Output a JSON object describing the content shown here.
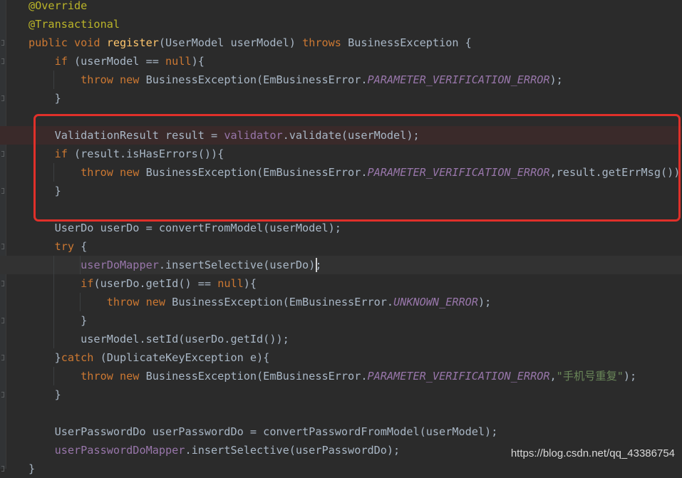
{
  "colors": {
    "background": "#2b2b2b",
    "keyword": "#cc7832",
    "annotation": "#bbb529",
    "method_declaration": "#ffc66d",
    "constant_italic": "#9876aa",
    "string": "#6a8759",
    "plain": "#a9b7c6",
    "highlight_box": "#e0302a"
  },
  "code_lines": [
    [
      {
        "t": "ann",
        "s": "@Override"
      }
    ],
    [
      {
        "t": "ann",
        "s": "@Transactional"
      }
    ],
    [
      {
        "t": "kw",
        "s": "public void "
      },
      {
        "t": "method",
        "s": "register"
      },
      {
        "t": "text",
        "s": "(UserModel userModel) "
      },
      {
        "t": "kw",
        "s": "throws "
      },
      {
        "t": "text",
        "s": "BusinessException {"
      }
    ],
    [
      {
        "t": "text",
        "s": "    "
      },
      {
        "t": "kw",
        "s": "if "
      },
      {
        "t": "text",
        "s": "(userModel == "
      },
      {
        "t": "kw",
        "s": "null"
      },
      {
        "t": "text",
        "s": "){"
      }
    ],
    [
      {
        "t": "text",
        "s": "        "
      },
      {
        "t": "kw",
        "s": "throw new "
      },
      {
        "t": "text",
        "s": "BusinessException(EmBusinessError."
      },
      {
        "t": "const",
        "s": "PARAMETER_VERIFICATION_ERROR"
      },
      {
        "t": "text",
        "s": ");"
      }
    ],
    [
      {
        "t": "text",
        "s": "    }"
      }
    ],
    [],
    [
      {
        "t": "text",
        "s": "    ValidationResult result = "
      },
      {
        "t": "field",
        "s": "validator"
      },
      {
        "t": "text",
        "s": ".validate(userModel);"
      }
    ],
    [
      {
        "t": "text",
        "s": "    "
      },
      {
        "t": "kw",
        "s": "if "
      },
      {
        "t": "text",
        "s": "(result.isHasErrors()){"
      }
    ],
    [
      {
        "t": "text",
        "s": "        "
      },
      {
        "t": "kw",
        "s": "throw new "
      },
      {
        "t": "text",
        "s": "BusinessException(EmBusinessError."
      },
      {
        "t": "const",
        "s": "PARAMETER_VERIFICATION_ERROR"
      },
      {
        "t": "text",
        "s": ",result.getErrMsg());"
      }
    ],
    [
      {
        "t": "text",
        "s": "    }"
      }
    ],
    [],
    [
      {
        "t": "text",
        "s": "    UserDo userDo = convertFromModel(userModel);"
      }
    ],
    [
      {
        "t": "text",
        "s": "    "
      },
      {
        "t": "kw",
        "s": "try "
      },
      {
        "t": "text",
        "s": "{"
      }
    ],
    [
      {
        "t": "text",
        "s": "        "
      },
      {
        "t": "field",
        "s": "userDoMapper"
      },
      {
        "t": "text",
        "s": ".insertSelective(userDo);"
      }
    ],
    [
      {
        "t": "text",
        "s": "        "
      },
      {
        "t": "kw",
        "s": "if"
      },
      {
        "t": "text",
        "s": "(userDo.getId() == "
      },
      {
        "t": "kw",
        "s": "null"
      },
      {
        "t": "text",
        "s": "){"
      }
    ],
    [
      {
        "t": "text",
        "s": "            "
      },
      {
        "t": "kw",
        "s": "throw new "
      },
      {
        "t": "text",
        "s": "BusinessException(EmBusinessError."
      },
      {
        "t": "const",
        "s": "UNKNOWN_ERROR"
      },
      {
        "t": "text",
        "s": ");"
      }
    ],
    [
      {
        "t": "text",
        "s": "        }"
      }
    ],
    [
      {
        "t": "text",
        "s": "        userModel.setId(userDo.getId());"
      }
    ],
    [
      {
        "t": "text",
        "s": "    }"
      },
      {
        "t": "kw",
        "s": "catch "
      },
      {
        "t": "text",
        "s": "(DuplicateKeyException e){"
      }
    ],
    [
      {
        "t": "text",
        "s": "        "
      },
      {
        "t": "kw",
        "s": "throw new "
      },
      {
        "t": "text",
        "s": "BusinessException(EmBusinessError."
      },
      {
        "t": "const",
        "s": "PARAMETER_VERIFICATION_ERROR"
      },
      {
        "t": "text",
        "s": ","
      },
      {
        "t": "str",
        "s": "\"手机号重复\""
      },
      {
        "t": "text",
        "s": ");"
      }
    ],
    [
      {
        "t": "text",
        "s": "    }"
      }
    ],
    [],
    [
      {
        "t": "text",
        "s": "    UserPasswordDo userPasswordDo = convertPasswordFromModel(userModel);"
      }
    ],
    [
      {
        "t": "text",
        "s": "    "
      },
      {
        "t": "field",
        "s": "userPasswordDoMapper"
      },
      {
        "t": "text",
        "s": ".insertSelective(userPasswordDo);"
      }
    ],
    [
      {
        "t": "text",
        "s": "}"
      }
    ]
  ],
  "watermark": "https://blog.csdn.net/qq_43386754"
}
